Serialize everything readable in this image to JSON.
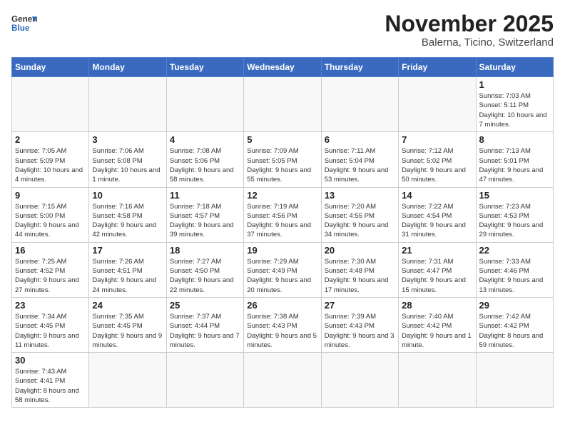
{
  "logo": {
    "text_general": "General",
    "text_blue": "Blue"
  },
  "title": {
    "month_year": "November 2025",
    "location": "Balerna, Ticino, Switzerland"
  },
  "days_of_week": [
    "Sunday",
    "Monday",
    "Tuesday",
    "Wednesday",
    "Thursday",
    "Friday",
    "Saturday"
  ],
  "weeks": [
    [
      {
        "day": "",
        "info": ""
      },
      {
        "day": "",
        "info": ""
      },
      {
        "day": "",
        "info": ""
      },
      {
        "day": "",
        "info": ""
      },
      {
        "day": "",
        "info": ""
      },
      {
        "day": "",
        "info": ""
      },
      {
        "day": "1",
        "info": "Sunrise: 7:03 AM\nSunset: 5:11 PM\nDaylight: 10 hours and 7 minutes."
      }
    ],
    [
      {
        "day": "2",
        "info": "Sunrise: 7:05 AM\nSunset: 5:09 PM\nDaylight: 10 hours and 4 minutes."
      },
      {
        "day": "3",
        "info": "Sunrise: 7:06 AM\nSunset: 5:08 PM\nDaylight: 10 hours and 1 minute."
      },
      {
        "day": "4",
        "info": "Sunrise: 7:08 AM\nSunset: 5:06 PM\nDaylight: 9 hours and 58 minutes."
      },
      {
        "day": "5",
        "info": "Sunrise: 7:09 AM\nSunset: 5:05 PM\nDaylight: 9 hours and 55 minutes."
      },
      {
        "day": "6",
        "info": "Sunrise: 7:11 AM\nSunset: 5:04 PM\nDaylight: 9 hours and 53 minutes."
      },
      {
        "day": "7",
        "info": "Sunrise: 7:12 AM\nSunset: 5:02 PM\nDaylight: 9 hours and 50 minutes."
      },
      {
        "day": "8",
        "info": "Sunrise: 7:13 AM\nSunset: 5:01 PM\nDaylight: 9 hours and 47 minutes."
      }
    ],
    [
      {
        "day": "9",
        "info": "Sunrise: 7:15 AM\nSunset: 5:00 PM\nDaylight: 9 hours and 44 minutes."
      },
      {
        "day": "10",
        "info": "Sunrise: 7:16 AM\nSunset: 4:58 PM\nDaylight: 9 hours and 42 minutes."
      },
      {
        "day": "11",
        "info": "Sunrise: 7:18 AM\nSunset: 4:57 PM\nDaylight: 9 hours and 39 minutes."
      },
      {
        "day": "12",
        "info": "Sunrise: 7:19 AM\nSunset: 4:56 PM\nDaylight: 9 hours and 37 minutes."
      },
      {
        "day": "13",
        "info": "Sunrise: 7:20 AM\nSunset: 4:55 PM\nDaylight: 9 hours and 34 minutes."
      },
      {
        "day": "14",
        "info": "Sunrise: 7:22 AM\nSunset: 4:54 PM\nDaylight: 9 hours and 31 minutes."
      },
      {
        "day": "15",
        "info": "Sunrise: 7:23 AM\nSunset: 4:53 PM\nDaylight: 9 hours and 29 minutes."
      }
    ],
    [
      {
        "day": "16",
        "info": "Sunrise: 7:25 AM\nSunset: 4:52 PM\nDaylight: 9 hours and 27 minutes."
      },
      {
        "day": "17",
        "info": "Sunrise: 7:26 AM\nSunset: 4:51 PM\nDaylight: 9 hours and 24 minutes."
      },
      {
        "day": "18",
        "info": "Sunrise: 7:27 AM\nSunset: 4:50 PM\nDaylight: 9 hours and 22 minutes."
      },
      {
        "day": "19",
        "info": "Sunrise: 7:29 AM\nSunset: 4:49 PM\nDaylight: 9 hours and 20 minutes."
      },
      {
        "day": "20",
        "info": "Sunrise: 7:30 AM\nSunset: 4:48 PM\nDaylight: 9 hours and 17 minutes."
      },
      {
        "day": "21",
        "info": "Sunrise: 7:31 AM\nSunset: 4:47 PM\nDaylight: 9 hours and 15 minutes."
      },
      {
        "day": "22",
        "info": "Sunrise: 7:33 AM\nSunset: 4:46 PM\nDaylight: 9 hours and 13 minutes."
      }
    ],
    [
      {
        "day": "23",
        "info": "Sunrise: 7:34 AM\nSunset: 4:45 PM\nDaylight: 9 hours and 11 minutes."
      },
      {
        "day": "24",
        "info": "Sunrise: 7:35 AM\nSunset: 4:45 PM\nDaylight: 9 hours and 9 minutes."
      },
      {
        "day": "25",
        "info": "Sunrise: 7:37 AM\nSunset: 4:44 PM\nDaylight: 9 hours and 7 minutes."
      },
      {
        "day": "26",
        "info": "Sunrise: 7:38 AM\nSunset: 4:43 PM\nDaylight: 9 hours and 5 minutes."
      },
      {
        "day": "27",
        "info": "Sunrise: 7:39 AM\nSunset: 4:43 PM\nDaylight: 9 hours and 3 minutes."
      },
      {
        "day": "28",
        "info": "Sunrise: 7:40 AM\nSunset: 4:42 PM\nDaylight: 9 hours and 1 minute."
      },
      {
        "day": "29",
        "info": "Sunrise: 7:42 AM\nSunset: 4:42 PM\nDaylight: 8 hours and 59 minutes."
      }
    ],
    [
      {
        "day": "30",
        "info": "Sunrise: 7:43 AM\nSunset: 4:41 PM\nDaylight: 8 hours and 58 minutes."
      },
      {
        "day": "",
        "info": ""
      },
      {
        "day": "",
        "info": ""
      },
      {
        "day": "",
        "info": ""
      },
      {
        "day": "",
        "info": ""
      },
      {
        "day": "",
        "info": ""
      },
      {
        "day": "",
        "info": ""
      }
    ]
  ]
}
